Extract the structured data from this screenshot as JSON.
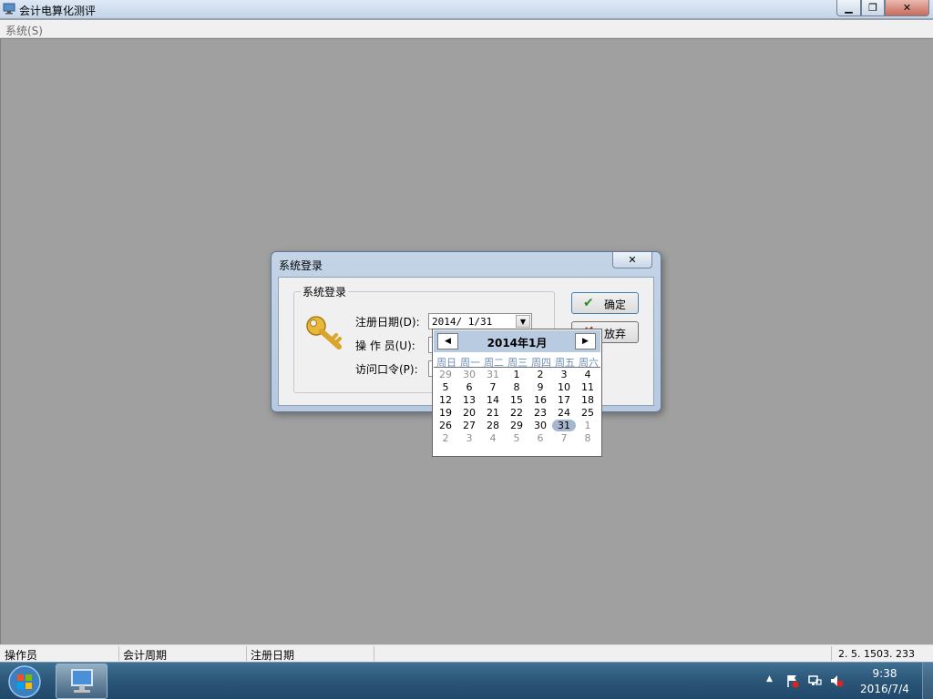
{
  "window": {
    "title": "会计电算化测评",
    "minimize_glyph": "▁",
    "maximize_glyph": "❐",
    "close_glyph": "✕"
  },
  "menu": {
    "system": "系统(S)"
  },
  "dialog": {
    "title": "系统登录",
    "close_glyph": "✕",
    "group_title": "系统登录",
    "date_label": "注册日期(D):",
    "date_value": "2014/ 1/31",
    "operator_label": "操 作 员(U):",
    "password_label": "访问口令(P):",
    "ok_label": "确定",
    "cancel_label": "放弃"
  },
  "calendar": {
    "title": "2014年1月",
    "weekdays": [
      "周日",
      "周一",
      "周二",
      "周三",
      "周四",
      "周五",
      "周六"
    ],
    "weeks": [
      [
        "29",
        "30",
        "31",
        "1",
        "2",
        "3",
        "4"
      ],
      [
        "5",
        "6",
        "7",
        "8",
        "9",
        "10",
        "11"
      ],
      [
        "12",
        "13",
        "14",
        "15",
        "16",
        "17",
        "18"
      ],
      [
        "19",
        "20",
        "21",
        "22",
        "23",
        "24",
        "25"
      ],
      [
        "26",
        "27",
        "28",
        "29",
        "30",
        "31",
        "1"
      ],
      [
        "2",
        "3",
        "4",
        "5",
        "6",
        "7",
        "8"
      ]
    ],
    "selected_day": "31"
  },
  "statusbar": {
    "operator": "操作员",
    "period": "会计周期",
    "reg_date": "注册日期",
    "version": "2. 5. 1503. 233"
  },
  "taskbar": {
    "time": "9:38",
    "date": "2016/7/4"
  },
  "icons": {
    "app": "computer-icon",
    "key": "key-icon",
    "ok": "checkmark-icon",
    "cancel": "x-icon",
    "tray": [
      "action-center-flag-icon",
      "network-icon",
      "volume-muted-icon"
    ]
  },
  "colors": {
    "workspace": "#a0a0a0",
    "taskbar": "#2b5677",
    "calendar_header": "#b8cbe0",
    "selected_day": "#a7b6cf"
  }
}
